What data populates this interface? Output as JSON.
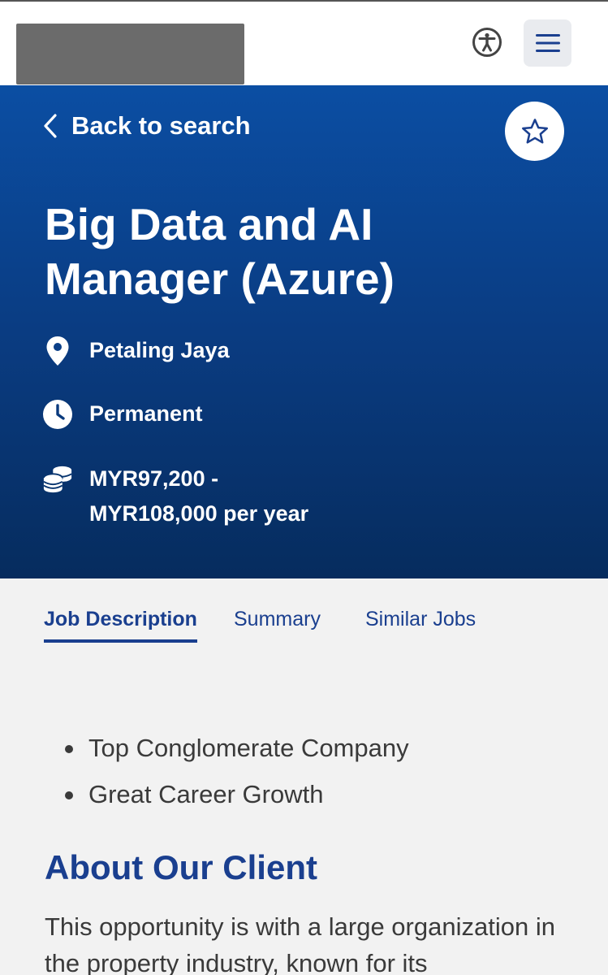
{
  "header": {
    "accessibility_icon": "accessibility-icon",
    "menu_icon": "hamburger-menu-icon"
  },
  "hero": {
    "back_label": "Back to search",
    "back_icon": "chevron-left-icon",
    "favorite_icon": "star-outline-icon",
    "title": "Big Data and AI Manager (Azure)",
    "location": "Petaling Jaya",
    "location_icon": "map-pin-icon",
    "job_type": "Permanent",
    "job_type_icon": "clock-icon",
    "salary": "MYR97,200 - MYR108,000 per year",
    "salary_icon": "coins-icon"
  },
  "tabs": [
    {
      "label": "Job Description",
      "active": true
    },
    {
      "label": "Summary",
      "active": false
    },
    {
      "label": "Similar Jobs",
      "active": false
    }
  ],
  "content": {
    "highlights": [
      "Top Conglomerate Company",
      "Great Career Growth"
    ],
    "about_heading": "About Our Client",
    "about_text": "This opportunity is with a large organization in the property industry, known for its"
  },
  "colors": {
    "brand_blue": "#1a3f8f",
    "hero_top": "#0b4ea3",
    "hero_bottom": "#062c5e",
    "page_bg": "#f2f2f2"
  }
}
